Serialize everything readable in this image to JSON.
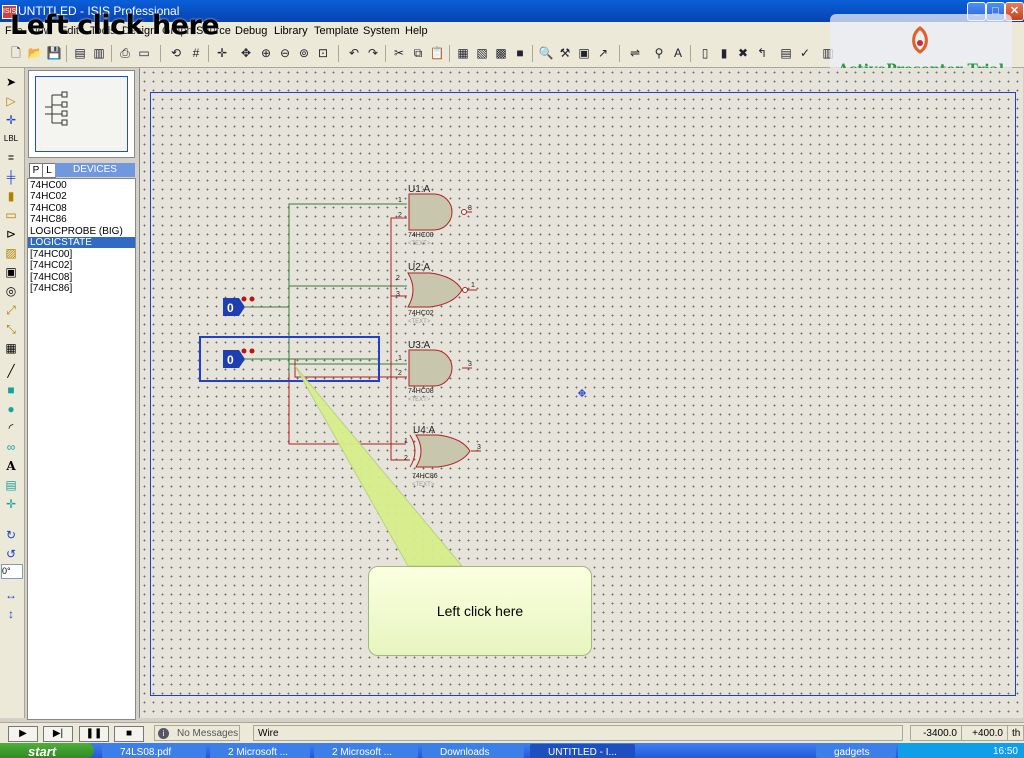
{
  "window": {
    "title": "UNTITLED - ISIS Professional"
  },
  "overlay_caption": "Left click here",
  "menu": [
    "File",
    "View",
    "Edit",
    "Tools",
    "Design",
    "Graph",
    "Source",
    "Debug",
    "Library",
    "Template",
    "System",
    "Help"
  ],
  "watermark": "ActivePresenter Trial",
  "device_panel": {
    "p_label": "P",
    "l_label": "L",
    "header": "DEVICES"
  },
  "devices": [
    "74HC00",
    "74HC02",
    "74HC08",
    "74HC86",
    "LOGICPROBE (BIG)",
    "LOGICSTATE",
    "[74HC00]",
    "[74HC02]",
    "[74HC08]",
    "[74HC86]"
  ],
  "selected_device_index": 5,
  "rotation": "0°",
  "schematic": {
    "gates": [
      {
        "ref": "U1:A",
        "part": "74HC00",
        "type": "nand",
        "pin_in1": "1",
        "pin_in2": "2",
        "pin_out": "3",
        "text": "<TEXT>"
      },
      {
        "ref": "U2:A",
        "part": "74HC02",
        "type": "nor",
        "pin_in1": "2",
        "pin_in2": "3",
        "pin_out": "1",
        "text": "<TEXT>"
      },
      {
        "ref": "U3:A",
        "part": "74HC08",
        "type": "and",
        "pin_in1": "1",
        "pin_in2": "2",
        "pin_out": "3",
        "text": "<TEXT>"
      },
      {
        "ref": "U4:A",
        "part": "74HC86",
        "type": "xor",
        "pin_in1": "1",
        "pin_in2": "2",
        "pin_out": "3",
        "text": "<TEXT>"
      }
    ],
    "logic_states": [
      "0",
      "0"
    ]
  },
  "callout": "Left click here",
  "status": {
    "messages": "No Messages",
    "mode": "Wire",
    "coord_x": "-3400.0",
    "coord_y": "+400.0",
    "unit": "th"
  },
  "taskbar": {
    "start": "start",
    "tasks": [
      "74LS08.pdf",
      "2 Microsoft ...",
      "2 Microsoft ...",
      "Downloads",
      "UNTITLED - I...",
      "gadgets"
    ],
    "clock": "16:50"
  },
  "colors": {
    "title_blue": "#0842b0",
    "wire_green": "#3a7a3a",
    "wire_red": "#b02020",
    "selection_blue": "#1e3fd0",
    "gate_fill": "#c9c6ae"
  }
}
